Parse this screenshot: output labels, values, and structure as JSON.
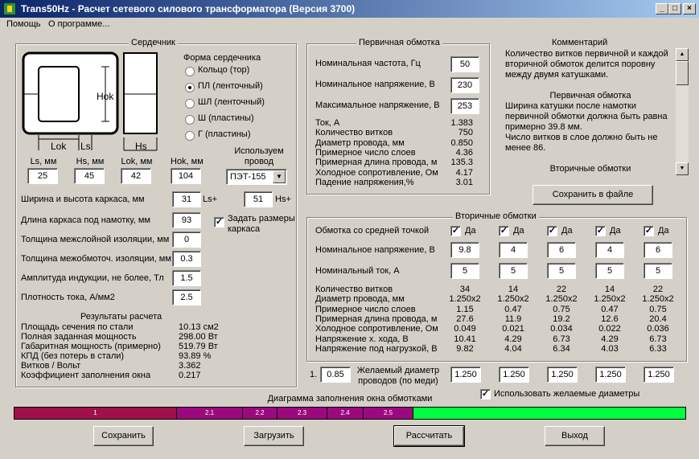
{
  "window": {
    "title": "Trans50Hz - Расчет сетевого силового трансформатора (Версия 3700)"
  },
  "menu": {
    "help": "Помощь",
    "about": "О программе..."
  },
  "core": {
    "title": "Сердечник",
    "diagram": {
      "hok": "Hok",
      "lok": "Lok",
      "ls": "Ls",
      "hs": "Hs"
    },
    "shape_title": "Форма сердечника",
    "shapes": [
      {
        "label": "Кольцо (тор)",
        "selected": false
      },
      {
        "label": "ПЛ (ленточный)",
        "selected": true
      },
      {
        "label": "ШЛ (ленточный)",
        "selected": false
      },
      {
        "label": "Ш (пластины)",
        "selected": false
      },
      {
        "label": "Г (пластины)",
        "selected": false
      }
    ],
    "dims": [
      {
        "label": "Ls, мм",
        "value": "25"
      },
      {
        "label": "Hs, мм",
        "value": "45"
      },
      {
        "label": "Lok, мм",
        "value": "42"
      },
      {
        "label": "Hok, мм",
        "value": "104"
      }
    ],
    "wire_title": "Используем провод",
    "wire_value": "ПЭТ-155",
    "frame_label": "Ширина и высота каркаса, мм",
    "frame_w": "31",
    "frame_w_suffix": "Ls+",
    "frame_h": "51",
    "frame_h_suffix": "Hs+",
    "length_label": "Длина каркаса под намотку, мм",
    "length_value": "93",
    "set_frame_label": "Задать размеры каркаса",
    "set_frame_checked": true,
    "params": [
      {
        "label": "Толщина межслойной изоляции, мм",
        "value": "0"
      },
      {
        "label": "Толщина межобмоточ. изоляции, мм",
        "value": "0.3"
      },
      {
        "label": "Амплитуда индукции, не более, Тл",
        "value": "1.5"
      },
      {
        "label": "Плотность тока, А/мм2",
        "value": "2.5"
      }
    ],
    "results_title": "Результаты расчета",
    "results": [
      {
        "label": "Площадь сечения по стали",
        "value": "10.13 см2"
      },
      {
        "label": "Полная заданная мощность",
        "value": "298.00 Вт"
      },
      {
        "label": "Габаритная мощность (примерно)",
        "value": "519.79 Вт"
      },
      {
        "label": "КПД (без потерь в стали)",
        "value": "93.89 %"
      },
      {
        "label": "Витков / Вольт",
        "value": "3.362"
      },
      {
        "label": "Коэффициент заполнения окна",
        "value": "0.217"
      }
    ]
  },
  "primary": {
    "title": "Первичная обмотка",
    "inputs": [
      {
        "label": "Номинальная частота, Гц",
        "value": "50"
      },
      {
        "label": "Номинальное напряжение, В",
        "value": "230"
      },
      {
        "label": "Максимальное напряжение, В",
        "value": "253"
      }
    ],
    "results": [
      {
        "label": "Ток, А",
        "value": "1.383"
      },
      {
        "label": "Количество витков",
        "value": "750"
      },
      {
        "label": "Диаметр провода, мм",
        "value": "0.850"
      },
      {
        "label": "Примерное число слоев",
        "value": "4.36"
      },
      {
        "label": "Примерная длина провода, м",
        "value": "135.3"
      },
      {
        "label": "Холодное сопротивление, Ом",
        "value": "4.17"
      },
      {
        "label": "Падение напряжения,%",
        "value": "3.01"
      }
    ]
  },
  "comment": {
    "title": "Комментарий",
    "lines": [
      "Количество витков первичной и каждой",
      "вторичной обмоток делится поровну",
      "между двумя катушками.",
      "",
      "Первичная обмотка",
      "Ширина катушки после намотки",
      "первичной обмотки должна быть равна",
      "примерно 39.8 мм.",
      "Число витков в слое должно быть не",
      "менее 86.",
      "",
      "Вторичные обмотки"
    ],
    "save_button": "Сохранить в файле"
  },
  "secondary": {
    "title": "Вторичные обмотки",
    "center_tap_label": "Обмотка со средней точкой",
    "yes_label": "Да",
    "voltage_label": "Номинальное напряжение, В",
    "current_label": "Номинальный ток, А",
    "windings": [
      {
        "center_tap": true,
        "voltage": "9.8",
        "current": "5",
        "turns": "34",
        "diameter": "1.250x2",
        "layers": "1.15",
        "length": "27.6",
        "resistance": "0.049",
        "voltage_nl": "10.41",
        "voltage_load": "9.82",
        "desired_d": "1.250"
      },
      {
        "center_tap": true,
        "voltage": "4",
        "current": "5",
        "turns": "14",
        "diameter": "1.250x2",
        "layers": "0.47",
        "length": "11.9",
        "resistance": "0.021",
        "voltage_nl": "4.29",
        "voltage_load": "4.04",
        "desired_d": "1.250"
      },
      {
        "center_tap": true,
        "voltage": "6",
        "current": "5",
        "turns": "22",
        "diameter": "1.250x2",
        "layers": "0.75",
        "length": "19.2",
        "resistance": "0.034",
        "voltage_nl": "6.73",
        "voltage_load": "6.34",
        "desired_d": "1.250"
      },
      {
        "center_tap": true,
        "voltage": "4",
        "current": "5",
        "turns": "14",
        "diameter": "1.250x2",
        "layers": "0.47",
        "length": "12.6",
        "resistance": "0.022",
        "voltage_nl": "4.29",
        "voltage_load": "4.03",
        "desired_d": "1.250"
      },
      {
        "center_tap": true,
        "voltage": "6",
        "current": "5",
        "turns": "22",
        "diameter": "1.250x2",
        "layers": "0.75",
        "length": "20.4",
        "resistance": "0.036",
        "voltage_nl": "6.73",
        "voltage_load": "6.33",
        "desired_d": "1.250"
      }
    ],
    "result_labels": [
      "Количество витков",
      "Диаметр провода, мм",
      "Примерное число слоев",
      "Примерная длина провода, м",
      "Холодное сопротивление, Ом",
      "Напряжение х. хода, В",
      "Напряжение под нагрузкой, В"
    ]
  },
  "desired": {
    "prefix": "1.",
    "primary_value": "0.85",
    "label_line1": "Желаемый диаметр",
    "label_line2": "проводов  (по меди)",
    "use_label": "Использовать желаемые диаметры",
    "use_checked": true
  },
  "fill": {
    "title": "Диаграмма заполнения окна обмотками",
    "segments": [
      {
        "label": "1",
        "fraction": 0.242,
        "color": "#a0104a"
      },
      {
        "label": "2.1",
        "fraction": 0.098,
        "color": "#9a0a7e"
      },
      {
        "label": "2.2",
        "fraction": 0.052,
        "color": "#9a0a7e"
      },
      {
        "label": "2.3",
        "fraction": 0.074,
        "color": "#9a0a7e"
      },
      {
        "label": "2.4",
        "fraction": 0.054,
        "color": "#9a0a7e"
      },
      {
        "label": "2.5",
        "fraction": 0.074,
        "color": "#9a0a7e"
      }
    ],
    "free_color": "#00ff40"
  },
  "buttons": {
    "save": "Сохранить",
    "load": "Загрузить",
    "calc": "Рассчитать",
    "exit": "Выход"
  }
}
